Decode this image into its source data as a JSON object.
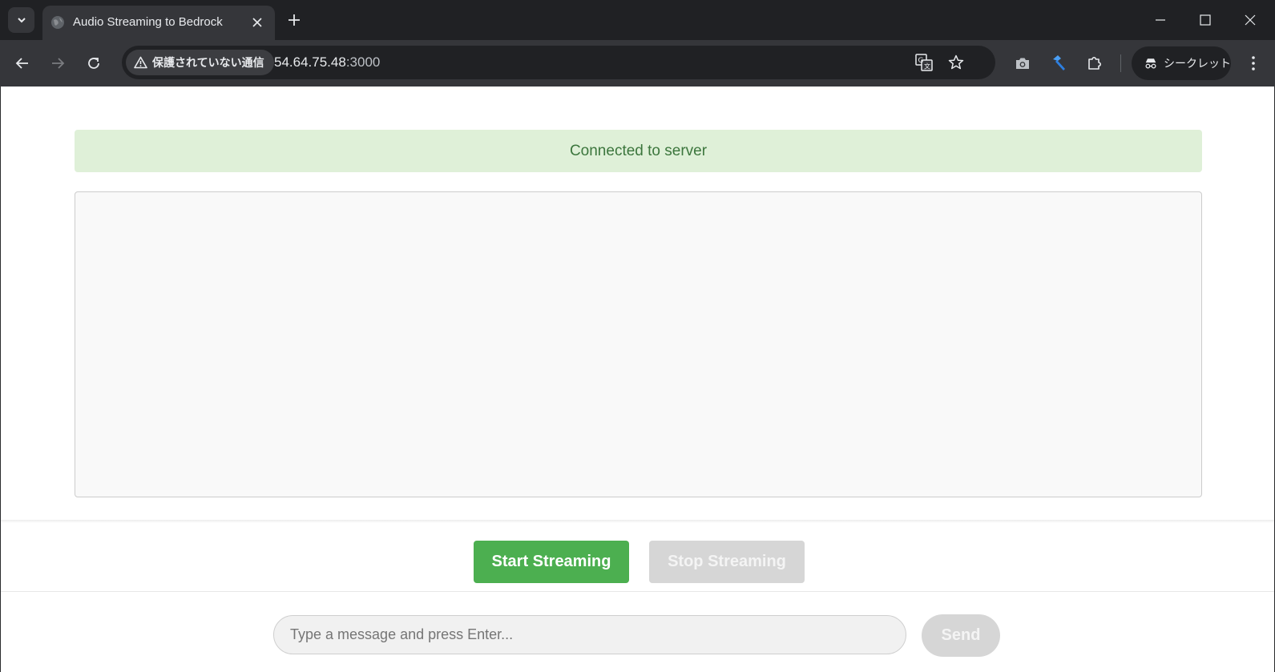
{
  "browser": {
    "tab": {
      "title": "Audio Streaming to Bedrock"
    },
    "address_bar": {
      "security_label": "保護されていない通信",
      "url_host": "54.64.75.48",
      "url_port": ":3000"
    },
    "incognito_label": "シークレット"
  },
  "page": {
    "status": "Connected to server",
    "controls": {
      "start_label": "Start Streaming",
      "stop_label": "Stop Streaming"
    },
    "message": {
      "placeholder": "Type a message and press Enter...",
      "send_label": "Send"
    }
  },
  "colors": {
    "status_bg": "#dff0d8",
    "status_text": "#3c763d",
    "start_button": "#4caf50",
    "disabled_button": "#d6d6d6"
  },
  "icons": {
    "tab_search": "chevron-down-icon",
    "favicon": "globe-icon",
    "tab_close": "close-icon",
    "new_tab": "plus-icon",
    "back": "arrow-left-icon",
    "forward": "arrow-right-icon",
    "reload": "reload-icon",
    "security": "warning-icon",
    "translate": "translate-icon",
    "bookmark": "star-icon",
    "screenshot": "camera-icon",
    "extension_pinned": "hammer-icon",
    "extensions": "puzzle-icon",
    "incognito": "incognito-icon",
    "menu": "kebab-menu-icon"
  }
}
